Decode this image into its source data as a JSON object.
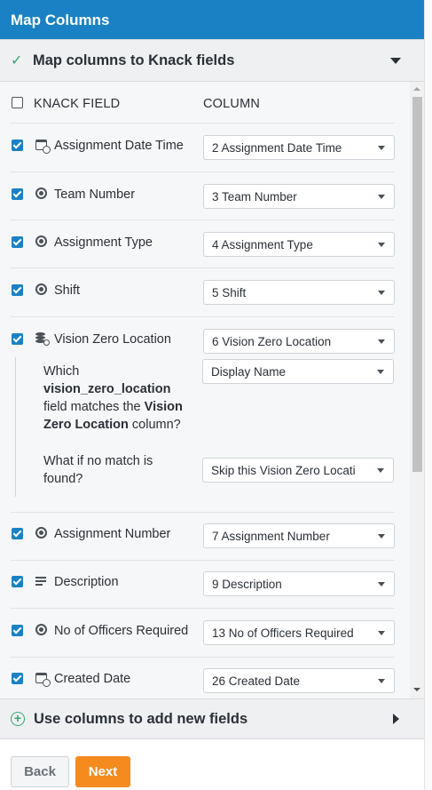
{
  "panel": {
    "title": "Map Columns"
  },
  "map_section": {
    "title": "Map columns to Knack fields"
  },
  "new_fields_section": {
    "title": "Use columns to add new fields"
  },
  "table": {
    "knack_field_header": "KNACK FIELD",
    "column_header": "COLUMN"
  },
  "rows": [
    {
      "field": "Assignment Date Time",
      "column": "2 Assignment Date Time",
      "icon": "calendar-clock-icon",
      "checked": true
    },
    {
      "field": "Team Number",
      "column": "3 Team Number",
      "icon": "radio-icon",
      "checked": true
    },
    {
      "field": "Assignment Type",
      "column": "4 Assignment Type",
      "icon": "radio-icon",
      "checked": true
    },
    {
      "field": "Shift",
      "column": "5 Shift",
      "icon": "radio-icon",
      "checked": true
    },
    {
      "field": "Vision Zero Location",
      "column": "6 Vision Zero Location",
      "icon": "connection-search-icon",
      "checked": true
    },
    {
      "field": "Assignment Number",
      "column": "7 Assignment Number",
      "icon": "radio-icon",
      "checked": true
    },
    {
      "field": "Description",
      "column": "9 Description",
      "icon": "paragraph-icon",
      "checked": true
    },
    {
      "field": "No of Officers Required",
      "column": "13 No of Officers Required",
      "icon": "radio-icon",
      "checked": true
    },
    {
      "field": "Created Date",
      "column": "26 Created Date",
      "icon": "calendar-clock-icon",
      "checked": true
    }
  ],
  "connection_options": {
    "q1_prefix": "Which",
    "q1_field": "vision_zero_location",
    "q1_mid": "field matches the",
    "q1_column": "Vision Zero Location",
    "q1_suffix": "column?",
    "match_field_value": "Display Name",
    "q2_text": "What if no match is found?",
    "no_match_value": "Skip this Vision Zero Locati"
  },
  "footer": {
    "back_label": "Back",
    "next_label": "Next"
  },
  "colors": {
    "header_bg": "#1a82c4",
    "accent_green": "#33a870",
    "next_button": "#f58a1f",
    "checkbox": "#1a82c4"
  }
}
